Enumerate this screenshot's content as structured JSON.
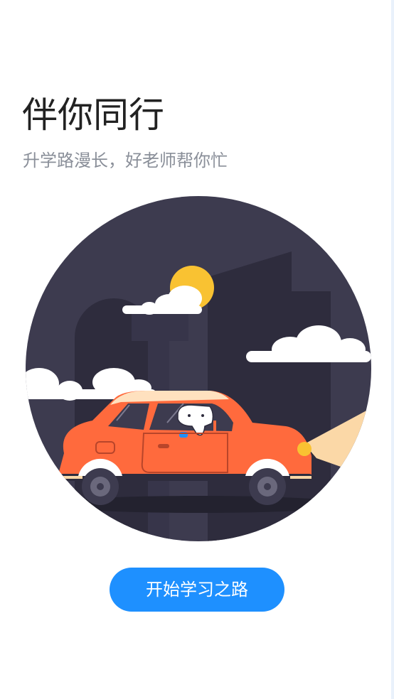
{
  "intro": {
    "title": "伴你同行",
    "subtitle": "升学路漫长，好老师帮你忙",
    "start_button_label": "开始学习之路"
  },
  "illustration": {
    "subject": "orange car with elephant driver in city at dusk"
  },
  "colors": {
    "accent": "#1e90ff",
    "title": "#222222",
    "subtitle": "#8a8f99",
    "circle_bg": "#3d3b4f",
    "car_body": "#ff6a3d",
    "sun": "#f9c232"
  }
}
